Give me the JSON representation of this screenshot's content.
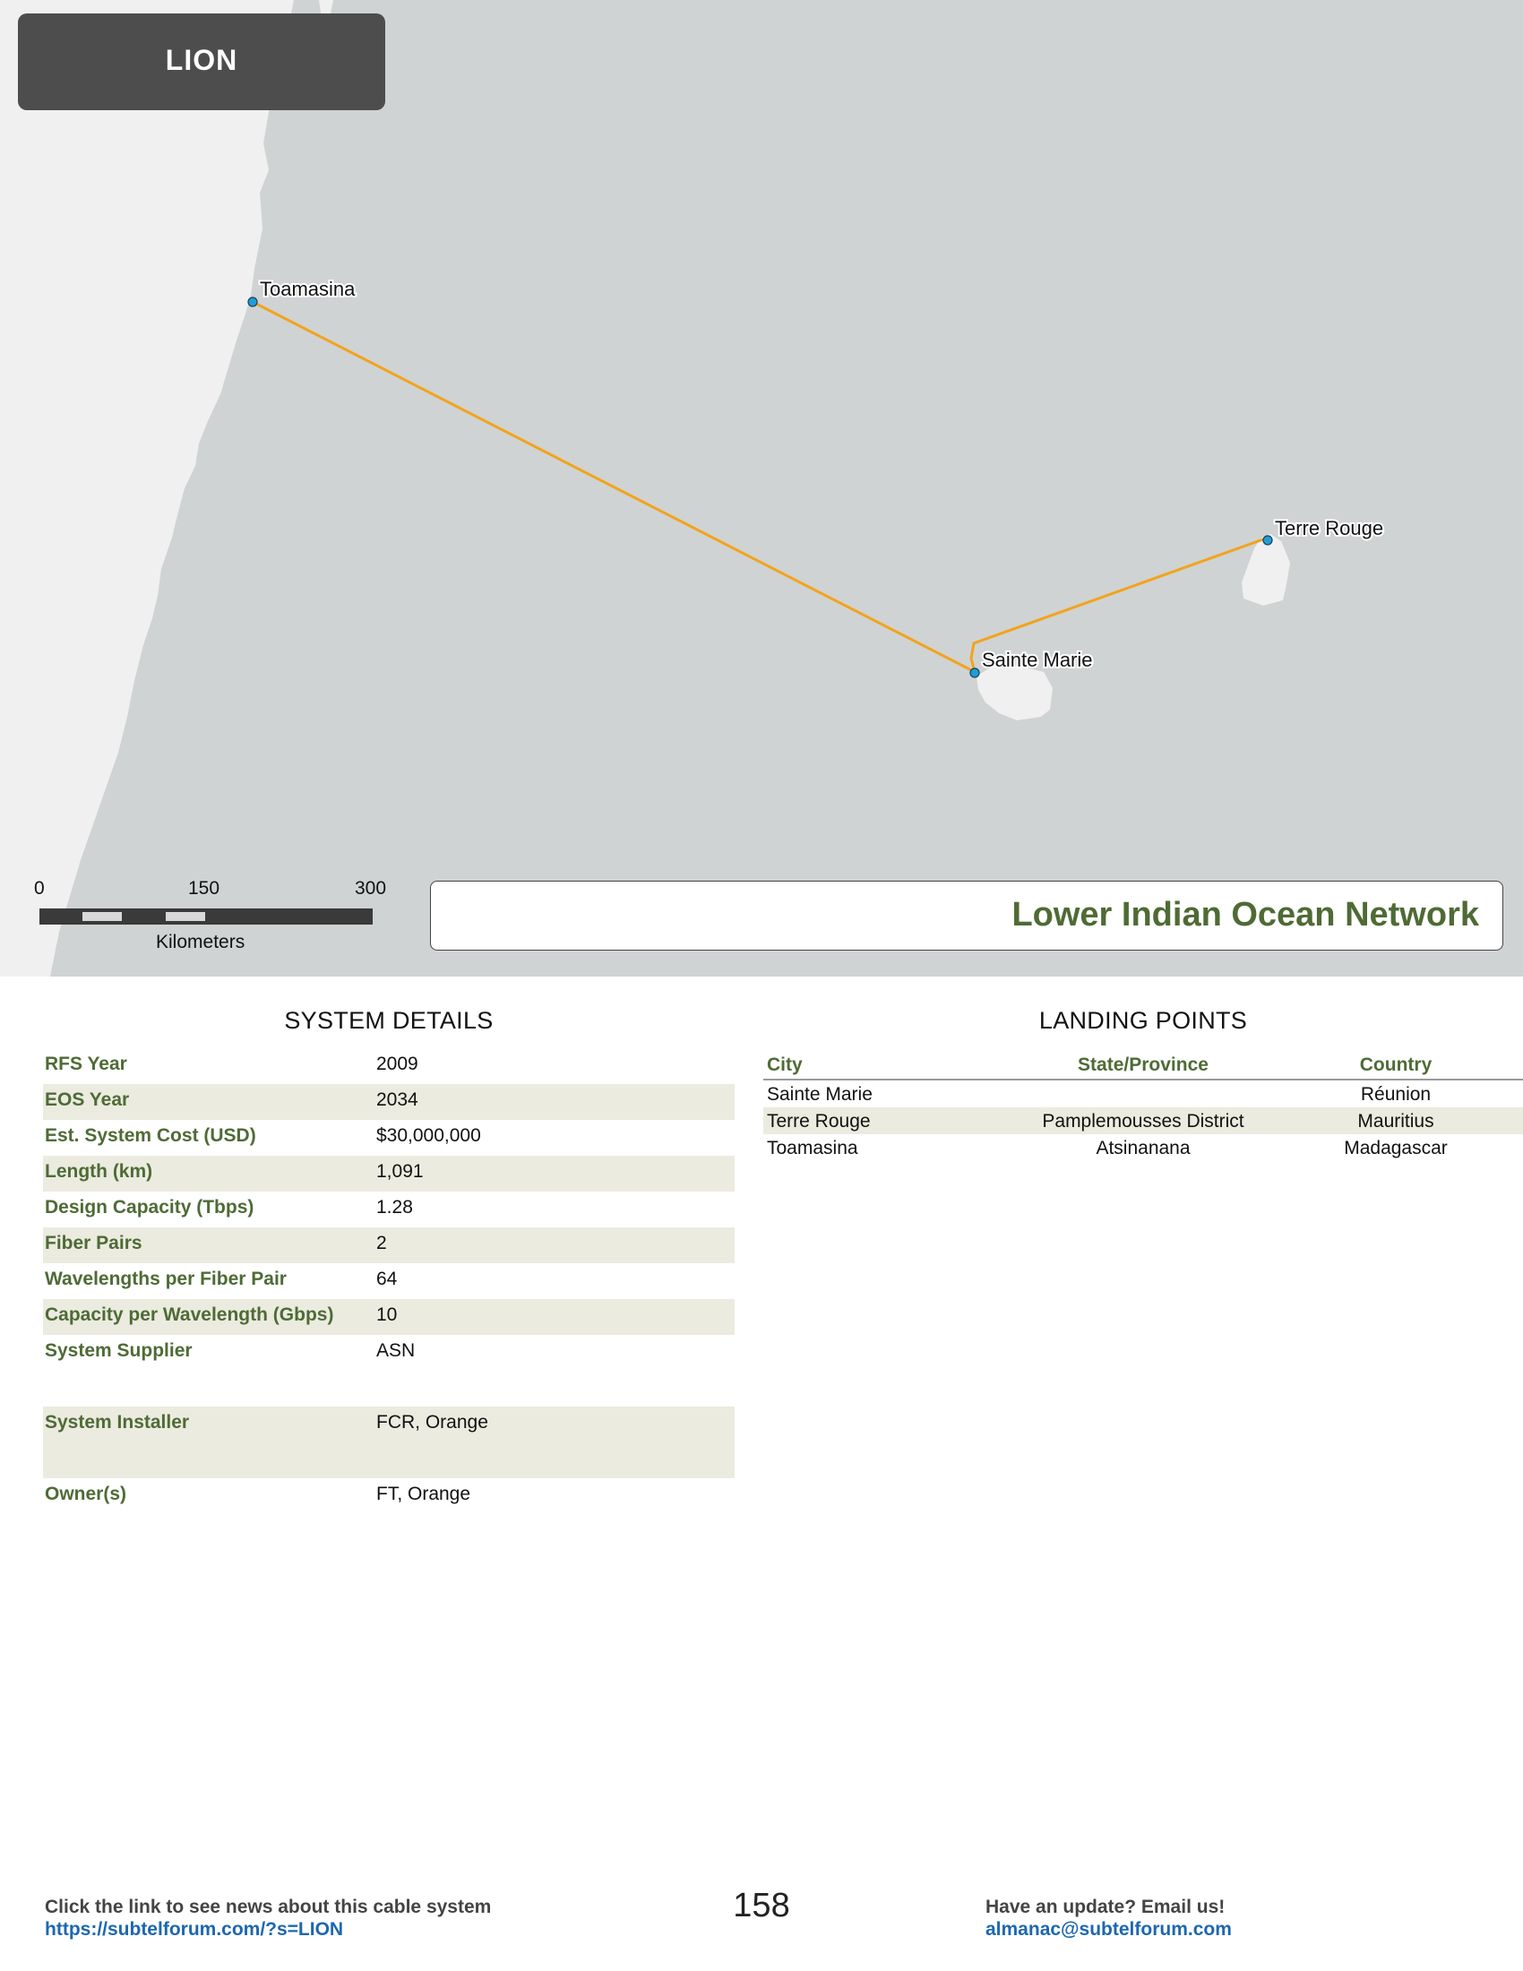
{
  "header": {
    "system_code": "LION"
  },
  "map": {
    "landing_labels": [
      {
        "name": "Toamasina"
      },
      {
        "name": "Sainte Marie"
      },
      {
        "name": "Terre Rouge"
      }
    ],
    "cable_color": "#f3a31b",
    "landing_dot_color": "#1f9ed6",
    "sea_color": "#cfd3d4",
    "land_color": "#f0f0f0",
    "scale": {
      "ticks": [
        "0",
        "150",
        "300"
      ],
      "unit": "Kilometers"
    },
    "network_name": "Lower Indian Ocean Network"
  },
  "system_details": {
    "title": "SYSTEM DETAILS",
    "rows": [
      {
        "label": "RFS Year",
        "value": "2009"
      },
      {
        "label": "EOS Year",
        "value": "2034"
      },
      {
        "label": "Est. System Cost (USD)",
        "value": "$30,000,000"
      },
      {
        "label": "Length (km)",
        "value": "1,091"
      },
      {
        "label": "Design Capacity (Tbps)",
        "value": "1.28"
      },
      {
        "label": "Fiber Pairs",
        "value": "2"
      },
      {
        "label": "Wavelengths per Fiber Pair",
        "value": "64"
      },
      {
        "label": "Capacity per Wavelength (Gbps)",
        "value": "10"
      },
      {
        "label": "System Supplier",
        "value": "ASN"
      },
      {
        "label": "System Installer",
        "value": "FCR, Orange"
      },
      {
        "label": "Owner(s)",
        "value": "FT, Orange"
      }
    ]
  },
  "landing_points": {
    "title": "LANDING POINTS",
    "columns": [
      "City",
      "State/Province",
      "Country"
    ],
    "rows": [
      {
        "city": "Sainte Marie",
        "state": "",
        "country": "Réunion"
      },
      {
        "city": "Terre Rouge",
        "state": "Pamplemousses District",
        "country": "Mauritius"
      },
      {
        "city": "Toamasina",
        "state": "Atsinanana",
        "country": "Madagascar"
      }
    ]
  },
  "footer": {
    "news_text": "Click the link to see news about this cable system",
    "news_link": "https://subtelforum.com/?s=LION",
    "page_number": "158",
    "update_text": "Have an update? Email us!",
    "update_email": "almanac@subtelforum.com"
  }
}
